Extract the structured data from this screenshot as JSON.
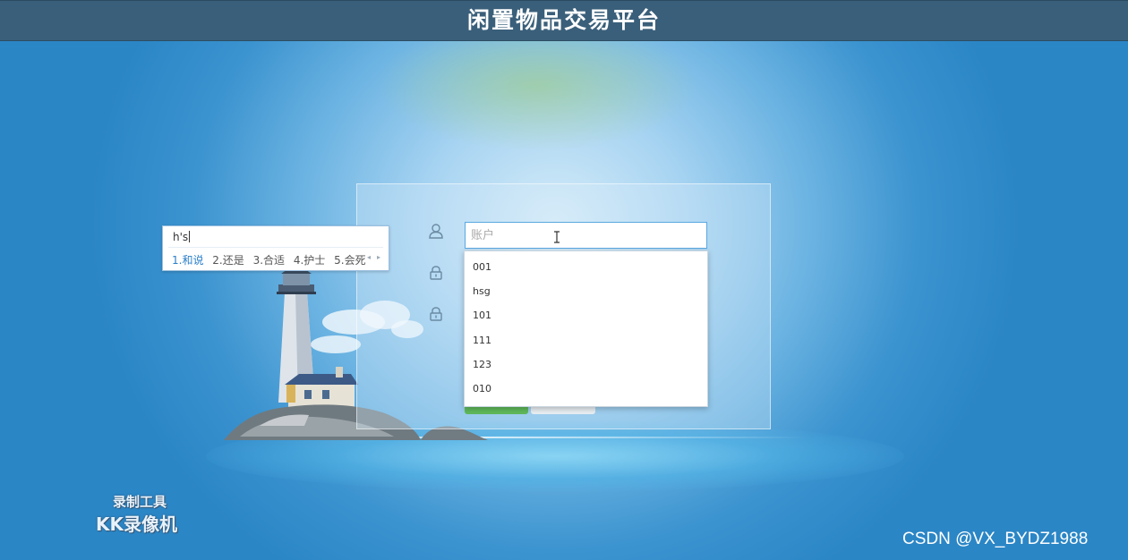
{
  "header": {
    "title": "闲置物品交易平台"
  },
  "login": {
    "account_placeholder": "账户"
  },
  "account_suggestions": [
    "001",
    "hsg",
    "101",
    "111",
    "123",
    "010"
  ],
  "ime": {
    "input": "h's",
    "candidates": [
      "1.和说",
      "2.还是",
      "3.合适",
      "4.护士",
      "5.会死"
    ]
  },
  "watermarks": {
    "tool_label": "录制工具",
    "tool_name": "KK录像机",
    "csdn": "CSDN @VX_BYDZ1988"
  },
  "colors": {
    "header_bg": "#3a5f7a",
    "accent_blue": "#2a7fc9",
    "login_button": "#5fb95a"
  },
  "icons": {
    "account": "user-icon",
    "password": "lock-icon",
    "confirm": "lock-icon"
  }
}
